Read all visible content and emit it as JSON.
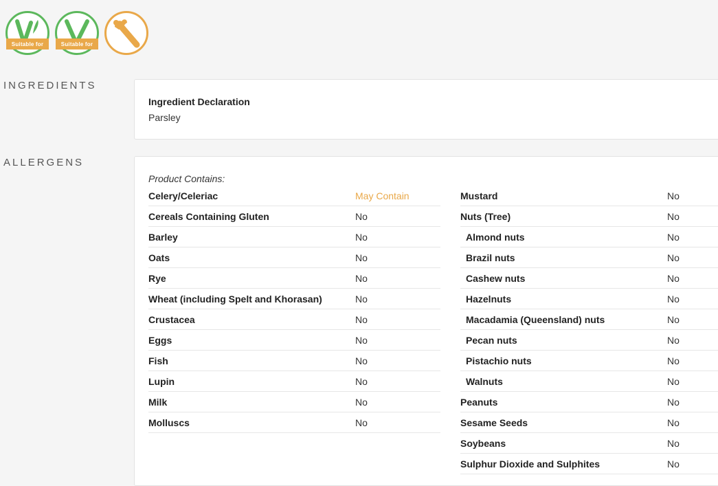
{
  "badges": [
    {
      "name": "vegan-badge",
      "label": "Suitable for",
      "color": "#5cb85c"
    },
    {
      "name": "vegetarian-badge",
      "label": "Suitable for",
      "color": "#5cb85c"
    },
    {
      "name": "celery-badge",
      "color": "#e9a849"
    }
  ],
  "ingredients": {
    "section_label": "INGREDIENTS",
    "title": "Ingredient Declaration",
    "value": "Parsley"
  },
  "allergens": {
    "section_label": "ALLERGENS",
    "contains_label": "Product Contains:",
    "left": [
      {
        "name": "Celery/Celeriac",
        "value": "May Contain",
        "warn": true
      },
      {
        "name": "Cereals Containing Gluten",
        "value": "No"
      },
      {
        "name": "Barley",
        "value": "No"
      },
      {
        "name": "Oats",
        "value": "No"
      },
      {
        "name": "Rye",
        "value": "No"
      },
      {
        "name": "Wheat (including Spelt and Khorasan)",
        "value": "No"
      },
      {
        "name": "Crustacea",
        "value": "No"
      },
      {
        "name": "Eggs",
        "value": "No"
      },
      {
        "name": "Fish",
        "value": "No"
      },
      {
        "name": "Lupin",
        "value": "No"
      },
      {
        "name": "Milk",
        "value": "No"
      },
      {
        "name": "Molluscs",
        "value": "No"
      }
    ],
    "right": [
      {
        "name": "Mustard",
        "value": "No"
      },
      {
        "name": "Nuts (Tree)",
        "value": "No"
      },
      {
        "name": "Almond nuts",
        "value": "No",
        "sub": true
      },
      {
        "name": "Brazil nuts",
        "value": "No",
        "sub": true
      },
      {
        "name": "Cashew nuts",
        "value": "No",
        "sub": true
      },
      {
        "name": "Hazelnuts",
        "value": "No",
        "sub": true
      },
      {
        "name": "Macadamia (Queensland) nuts",
        "value": "No",
        "sub": true
      },
      {
        "name": "Pecan nuts",
        "value": "No",
        "sub": true
      },
      {
        "name": "Pistachio nuts",
        "value": "No",
        "sub": true
      },
      {
        "name": "Walnuts",
        "value": "No",
        "sub": true
      },
      {
        "name": "Peanuts",
        "value": "No"
      },
      {
        "name": "Sesame Seeds",
        "value": "No"
      },
      {
        "name": "Soybeans",
        "value": "No"
      },
      {
        "name": "Sulphur Dioxide and Sulphites",
        "value": "No"
      }
    ]
  }
}
